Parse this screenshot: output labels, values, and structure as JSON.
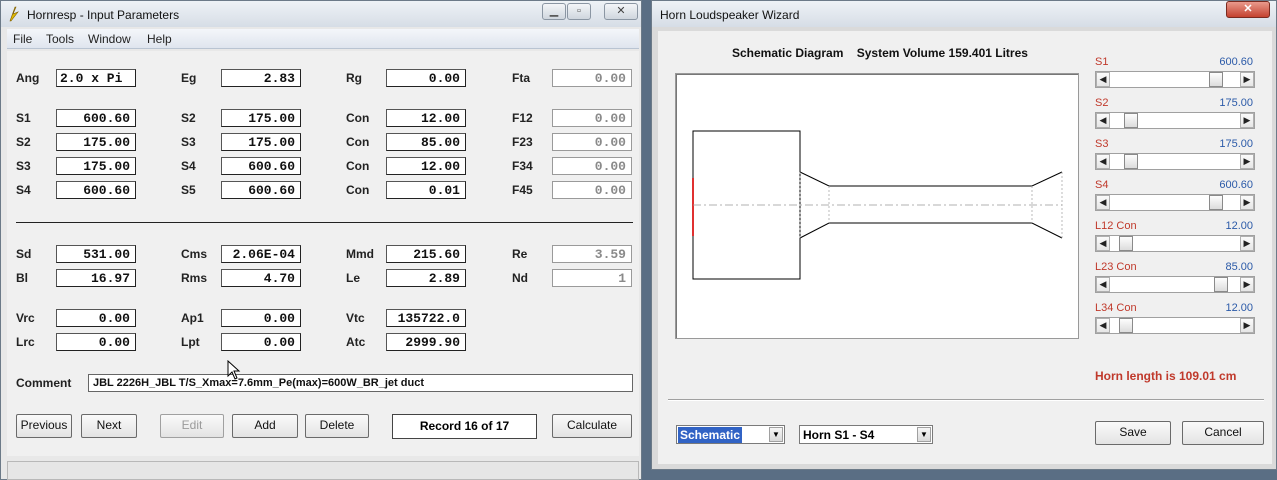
{
  "input_window": {
    "title": "Hornresp - Input Parameters",
    "menu": [
      "File",
      "Tools",
      "Window",
      "Help"
    ],
    "rows_top": [
      [
        {
          "label": "Ang",
          "value": "2.0 x Pi"
        },
        {
          "label": "Eg",
          "value": "2.83"
        },
        {
          "label": "Rg",
          "value": "0.00"
        },
        {
          "label": "Fta",
          "value": "0.00"
        }
      ],
      [
        {
          "label": "S1",
          "value": "600.60"
        },
        {
          "label": "S2",
          "value": "175.00"
        },
        {
          "label": "Con",
          "value": "12.00"
        },
        {
          "label": "F12",
          "value": "0.00"
        }
      ],
      [
        {
          "label": "S2",
          "value": "175.00"
        },
        {
          "label": "S3",
          "value": "175.00"
        },
        {
          "label": "Con",
          "value": "85.00"
        },
        {
          "label": "F23",
          "value": "0.00"
        }
      ],
      [
        {
          "label": "S3",
          "value": "175.00"
        },
        {
          "label": "S4",
          "value": "600.60"
        },
        {
          "label": "Con",
          "value": "12.00"
        },
        {
          "label": "F34",
          "value": "0.00"
        }
      ],
      [
        {
          "label": "S4",
          "value": "600.60"
        },
        {
          "label": "S5",
          "value": "600.60"
        },
        {
          "label": "Con",
          "value": "0.01"
        },
        {
          "label": "F45",
          "value": "0.00"
        }
      ]
    ],
    "rows_bottom": [
      [
        {
          "label": "Sd",
          "value": "531.00"
        },
        {
          "label": "Cms",
          "value": "2.06E-04"
        },
        {
          "label": "Mmd",
          "value": "215.60"
        },
        {
          "label": "Re",
          "value": "3.59"
        }
      ],
      [
        {
          "label": "Bl",
          "value": "16.97"
        },
        {
          "label": "Rms",
          "value": "4.70"
        },
        {
          "label": "Le",
          "value": "2.89"
        },
        {
          "label": "Nd",
          "value": "1"
        }
      ],
      [
        {
          "label": "Vrc",
          "value": "0.00"
        },
        {
          "label": "Ap1",
          "value": "0.00"
        },
        {
          "label": "Vtc",
          "value": "135722.0"
        }
      ],
      [
        {
          "label": "Lrc",
          "value": "0.00"
        },
        {
          "label": "Lpt",
          "value": "0.00"
        },
        {
          "label": "Atc",
          "value": "2999.90"
        }
      ]
    ],
    "comment_label": "Comment",
    "comment": "JBL 2226H_JBL T/S_Xmax=7.6mm_Pe(max)=600W_BR_jet duct",
    "buttons": {
      "previous": "Previous",
      "next": "Next",
      "edit": "Edit",
      "add": "Add",
      "delete": "Delete",
      "calculate": "Calculate"
    },
    "record": "Record 16 of 17"
  },
  "wizard": {
    "title": "Horn Loudspeaker Wizard",
    "diagram_title": "Schematic Diagram",
    "system_volume": "System Volume 159.401 Litres",
    "sliders": [
      {
        "label": "S1",
        "value": "600.60",
        "position": 0.85
      },
      {
        "label": "S2",
        "value": "175.00",
        "position": 0.12
      },
      {
        "label": "S3",
        "value": "175.00",
        "position": 0.12
      },
      {
        "label": "S4",
        "value": "600.60",
        "position": 0.85
      },
      {
        "label": "L12  Con",
        "value": "12.00",
        "position": 0.08
      },
      {
        "label": "L23  Con",
        "value": "85.00",
        "position": 0.9
      },
      {
        "label": "L34  Con",
        "value": "12.00",
        "position": 0.08
      }
    ],
    "horn_length": "Horn length is 109.01 cm",
    "view_select": "Schematic",
    "section_select": "Horn S1 - S4",
    "save": "Save",
    "cancel": "Cancel"
  },
  "colors": {
    "label_red": "#c0392b",
    "value_blue": "#2b5aa8",
    "selection": "#3163c5"
  },
  "icons": [
    "hornresp-app-icon",
    "minimize-icon",
    "maximize-icon",
    "close-icon",
    "mouse-cursor-icon"
  ]
}
